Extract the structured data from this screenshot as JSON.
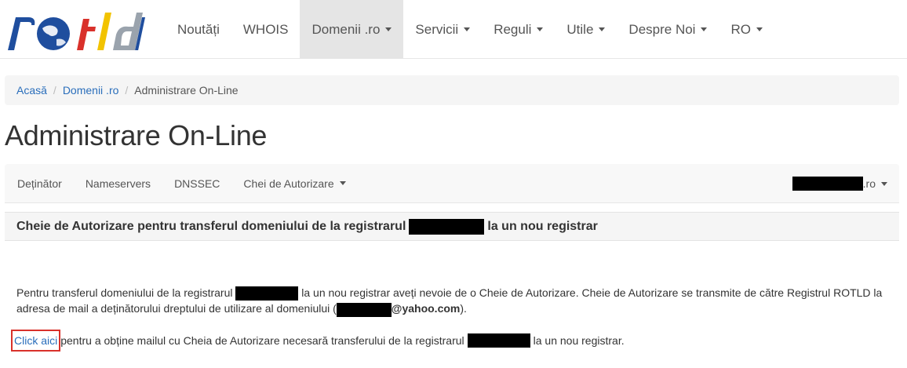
{
  "header": {
    "logo_alt": "rotld",
    "nav": [
      {
        "label": "Noutăți",
        "dropdown": false,
        "active": false
      },
      {
        "label": "WHOIS",
        "dropdown": false,
        "active": false
      },
      {
        "label": "Domenii .ro",
        "dropdown": true,
        "active": true
      },
      {
        "label": "Servicii",
        "dropdown": true,
        "active": false
      },
      {
        "label": "Reguli",
        "dropdown": true,
        "active": false
      },
      {
        "label": "Utile",
        "dropdown": true,
        "active": false
      },
      {
        "label": "Despre Noi",
        "dropdown": true,
        "active": false
      },
      {
        "label": "RO",
        "dropdown": true,
        "active": false
      }
    ]
  },
  "breadcrumb": {
    "items": [
      "Acasă",
      "Domenii .ro"
    ],
    "separator": "/",
    "current": "Administrare On-Line"
  },
  "page": {
    "title": "Administrare On-Line"
  },
  "subnav": {
    "items": [
      {
        "label": "Deținător",
        "dropdown": false
      },
      {
        "label": "Nameservers",
        "dropdown": false
      },
      {
        "label": "DNSSEC",
        "dropdown": false
      },
      {
        "label": "Chei de Autorizare",
        "dropdown": true
      }
    ],
    "domain_suffix": ".ro"
  },
  "panel": {
    "heading_before": "Cheie de Autorizare pentru transferul domeniului de la registrarul",
    "heading_after": "la un nou registrar"
  },
  "info": {
    "part1": "Pentru transferul domeniului de la registrarul",
    "part2": "la un nou registrar aveți nevoie de o Cheie de Autorizare. Cheie de Autorizare se transmite de către Registrul ROTLD la adresa de mail a deținătorului dreptului de utilizare al domeniului (",
    "email_domain": "@yahoo.com",
    "part3": ")."
  },
  "action": {
    "link_label": "Click aici",
    "text_before": "pentru a obține mailul cu Cheia de Autorizare necesară transferului de la registrarul",
    "text_after": "la un nou registrar."
  },
  "colors": {
    "link": "#2a6ebb",
    "highlight_border": "#d9312b",
    "active_nav_bg": "#e5e5e5",
    "logo_blue": "#1f4e9e",
    "logo_red": "#d9312b",
    "logo_yellow": "#f2c300"
  }
}
